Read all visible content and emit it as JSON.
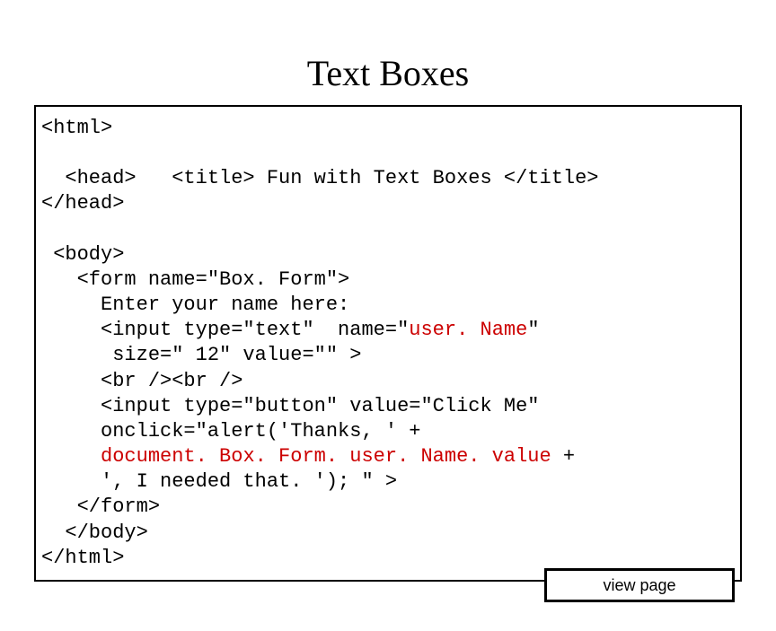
{
  "title": "Text Boxes",
  "code": {
    "l1": "<html>",
    "l2": "",
    "l3": "  <head>   <title> Fun with Text Boxes </title>",
    "l4": "</head>",
    "l5": "",
    "l6": " <body>",
    "l7": "   <form name=\"Box. Form\">",
    "l8": "     Enter your name here:",
    "l9a": "     <input type=\"text\"  name=\"",
    "l9b": "user. Name",
    "l9c": "\"",
    "l10": "      size=\" 12\" value=\"\" >",
    "l11": "     <br /><br />",
    "l12": "     <input type=\"button\" value=\"Click Me\"",
    "l13": "     onclick=\"alert('Thanks, ' +",
    "l14a": "     ",
    "l14b": "document. Box. Form. user. Name. value",
    "l14c": " +",
    "l15": "     ', I needed that. '); \" >",
    "l16": "   </form>",
    "l17": "  </body>",
    "l18": "</html>"
  },
  "button_label": "view page"
}
